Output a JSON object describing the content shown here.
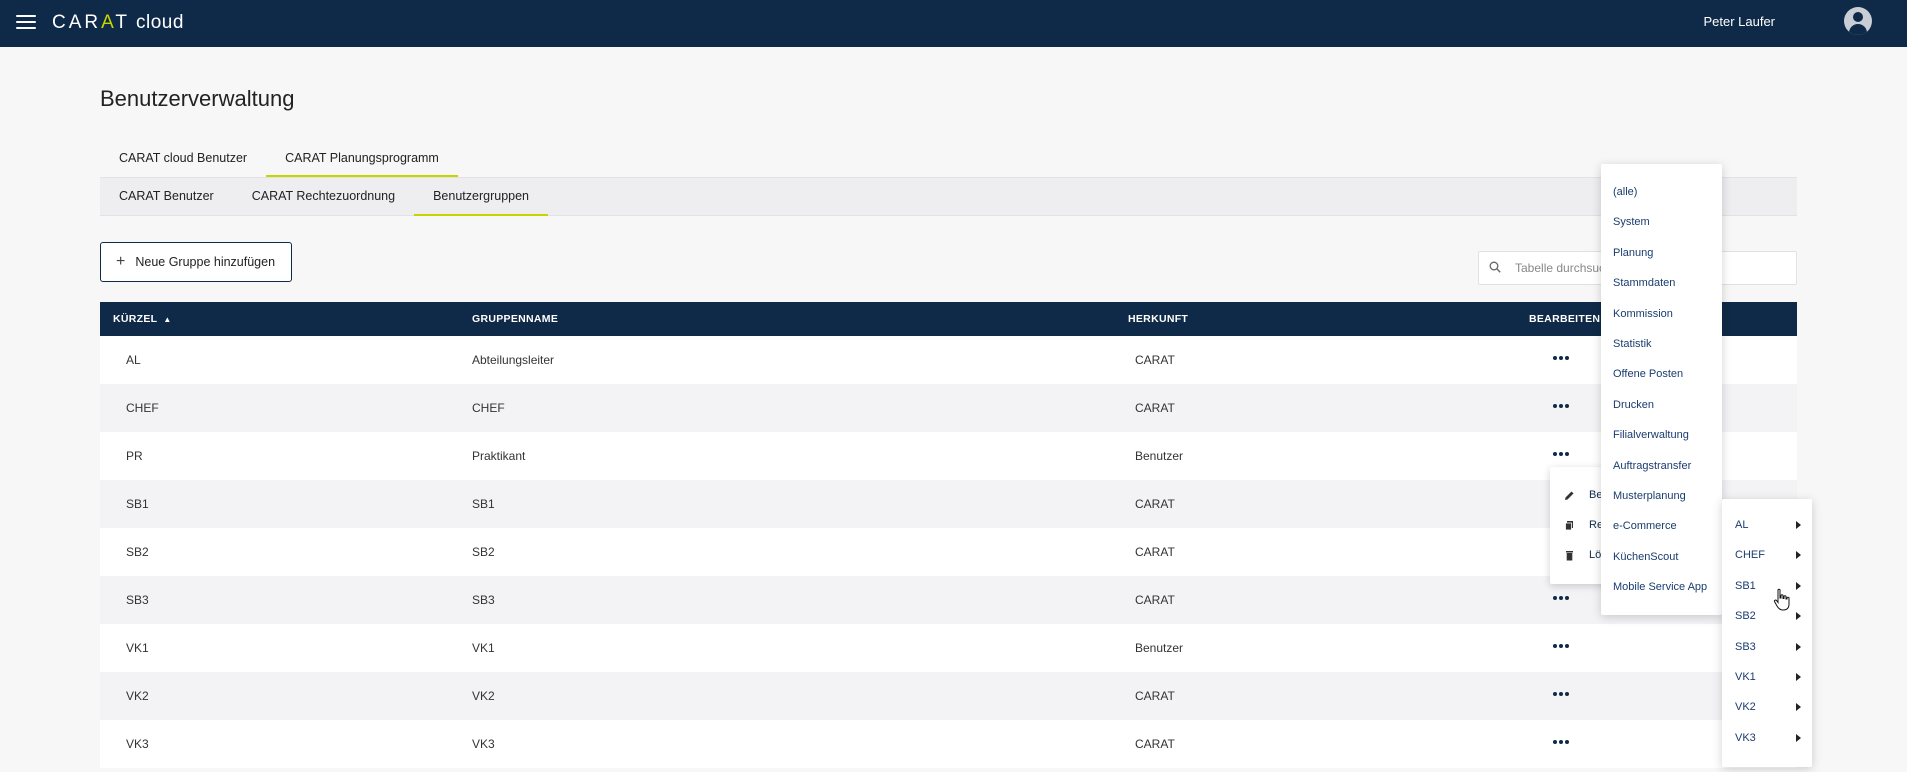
{
  "header": {
    "logo_brand_1": "CAR",
    "logo_brand_a": "A",
    "logo_brand_2": "T",
    "logo_suffix": "cloud",
    "user_name": "Peter Laufer"
  },
  "page": {
    "title": "Benutzerverwaltung"
  },
  "tabs_main": [
    {
      "label": "CARAT cloud Benutzer",
      "active": false
    },
    {
      "label": "CARAT Planungsprogramm",
      "active": true
    }
  ],
  "tabs_sub": [
    {
      "label": "CARAT Benutzer",
      "active": false
    },
    {
      "label": "CARAT Rechtezuordnung",
      "active": false
    },
    {
      "label": "Benutzergruppen",
      "active": true
    }
  ],
  "toolbar": {
    "add_label": "Neue Gruppe hinzufügen",
    "search_placeholder": "Tabelle durchsuchen"
  },
  "table": {
    "columns": [
      "KÜRZEL",
      "GRUPPENNAME",
      "HERKUNFT",
      "BEARBEITEN"
    ],
    "rows": [
      {
        "kuerzel": "AL",
        "name": "Abteilungsleiter",
        "herkunft": "CARAT"
      },
      {
        "kuerzel": "CHEF",
        "name": "CHEF",
        "herkunft": "CARAT"
      },
      {
        "kuerzel": "PR",
        "name": "Praktikant",
        "herkunft": "Benutzer"
      },
      {
        "kuerzel": "SB1",
        "name": "SB1",
        "herkunft": "CARAT"
      },
      {
        "kuerzel": "SB2",
        "name": "SB2",
        "herkunft": "CARAT"
      },
      {
        "kuerzel": "SB3",
        "name": "SB3",
        "herkunft": "CARAT"
      },
      {
        "kuerzel": "VK1",
        "name": "VK1",
        "herkunft": "Benutzer"
      },
      {
        "kuerzel": "VK2",
        "name": "VK2",
        "herkunft": "CARAT"
      },
      {
        "kuerzel": "VK3",
        "name": "VK3",
        "herkunft": "CARAT"
      }
    ]
  },
  "context_menu": {
    "items": [
      {
        "label": "Be",
        "icon": "pencil-icon"
      },
      {
        "label": "Re",
        "icon": "copy-icon"
      },
      {
        "label": "Lö",
        "icon": "trash-icon"
      }
    ]
  },
  "category_menu": {
    "items": [
      "(alle)",
      "System",
      "Planung",
      "Stammdaten",
      "Kommission",
      "Statistik",
      "Offene Posten",
      "Drucken",
      "Filialverwaltung",
      "Auftragstransfer",
      "Musterplanung",
      "e-Commerce",
      "KüchenScout",
      "Mobile Service App"
    ]
  },
  "group_submenu": {
    "items": [
      "AL",
      "CHEF",
      "SB1",
      "SB2",
      "SB3",
      "VK1",
      "VK2",
      "VK3"
    ]
  },
  "colors": {
    "navy": "#0f2a48",
    "accent": "#c8d400",
    "link": "#1a3c6e"
  }
}
